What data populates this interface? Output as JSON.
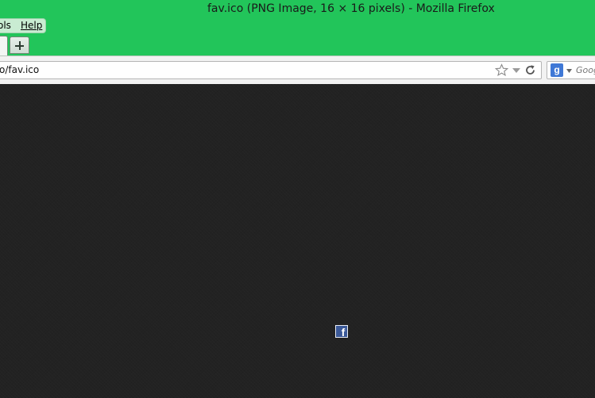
{
  "window": {
    "title": "fav.ico (PNG Image, 16 × 16 pixels) - Mozilla Firefox"
  },
  "menubar": {
    "items": [
      {
        "label": "ols"
      },
      {
        "label": "Help"
      }
    ]
  },
  "tabstrip": {
    "new_tab_icon": "plus-icon"
  },
  "navbar": {
    "url": "o/fav.ico",
    "icons": [
      "star-icon",
      "dropmarker-icon",
      "reload-icon"
    ]
  },
  "searchbar": {
    "engine_letter": "g",
    "placeholder": "Goog"
  },
  "content": {
    "image_letter": "f",
    "image_icon": "facebook-icon"
  },
  "colors": {
    "chrome_green": "#22c55a",
    "content_bg": "#222222",
    "facebook_blue": "#3b5998",
    "google_blue": "#3f78d6"
  }
}
